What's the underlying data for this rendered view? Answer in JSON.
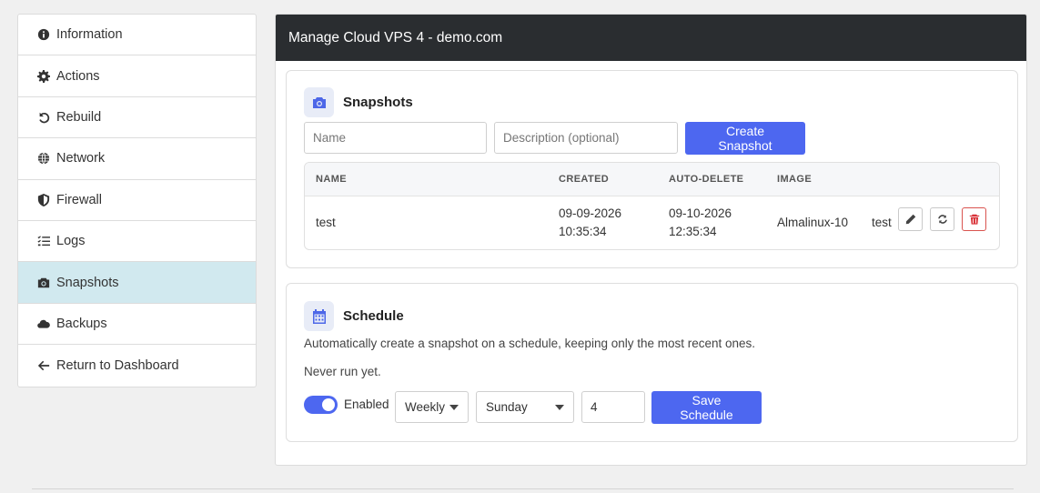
{
  "sidebar": {
    "items": [
      {
        "label": "Information",
        "icon": "info-circle-icon"
      },
      {
        "label": "Actions",
        "icon": "gear-icon"
      },
      {
        "label": "Rebuild",
        "icon": "undo-icon"
      },
      {
        "label": "Network",
        "icon": "globe-icon"
      },
      {
        "label": "Firewall",
        "icon": "shield-icon"
      },
      {
        "label": "Logs",
        "icon": "list-check-icon"
      },
      {
        "label": "Snapshots",
        "icon": "camera-icon",
        "active": true
      },
      {
        "label": "Backups",
        "icon": "cloud-icon"
      },
      {
        "label": "Return to Dashboard",
        "icon": "arrow-left-icon"
      }
    ]
  },
  "header": {
    "title": "Manage Cloud VPS 4 - demo.com"
  },
  "snapshots": {
    "title": "Snapshots",
    "name_placeholder": "Name",
    "description_placeholder": "Description (optional)",
    "create_label": "Create Snapshot",
    "columns": [
      "NAME",
      "CREATED",
      "AUTO-DELETE",
      "IMAGE"
    ],
    "rows": [
      {
        "name": "test",
        "created_date": "09-09-2026",
        "created_time": "10:35:34",
        "autodelete_date": "09-10-2026",
        "autodelete_time": "12:35:34",
        "image": "Almalinux-10",
        "description": "test"
      }
    ]
  },
  "schedule": {
    "title": "Schedule",
    "description": "Automatically create a snapshot on a schedule, keeping only the most recent ones.",
    "status": "Never run yet.",
    "enabled_label": "Enabled",
    "frequency": "Weekly",
    "day": "Sunday",
    "keep_count": "4",
    "save_label": "Save Schedule"
  },
  "colors": {
    "accent": "#4d67f0",
    "header_bg": "#2a2d30",
    "active_bg": "#d1e9ef",
    "danger": "#d9343a"
  }
}
